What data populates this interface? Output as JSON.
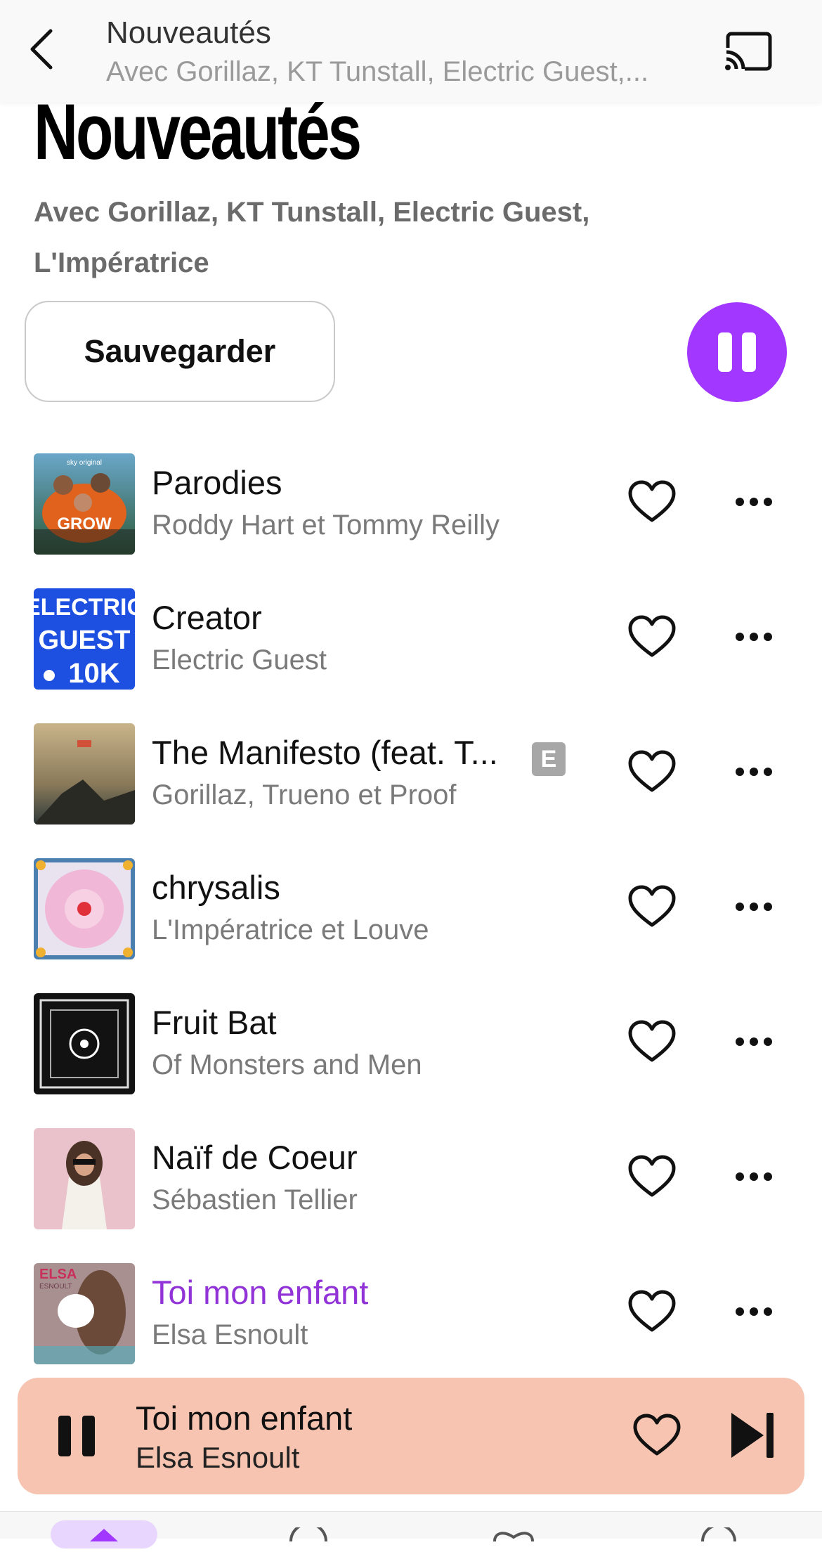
{
  "header": {
    "title": "Nouveautés",
    "subtitle": "Avec Gorillaz, KT Tunstall, Electric Guest,..."
  },
  "hero": {
    "title": "Nouveautés",
    "artists": "Avec Gorillaz, KT Tunstall, Electric Guest, L'Impératrice",
    "save_label": "Sauvegarder",
    "accent_color": "#a238ff"
  },
  "tracks": [
    {
      "title": "Parodies",
      "artist": "Roddy Hart et Tommy Reilly",
      "explicit": false,
      "playing": false,
      "cover_text": "GROW",
      "cover_top": "sky original"
    },
    {
      "title": "Creator",
      "artist": "Electric Guest",
      "explicit": false,
      "playing": false,
      "cover_text": "ELECTRIC GUEST 10K"
    },
    {
      "title": "The Manifesto (feat. T...",
      "artist": "Gorillaz, Trueno et Proof",
      "explicit": true,
      "explicit_label": "E",
      "playing": false
    },
    {
      "title": "chrysalis",
      "artist": "L'Impératrice et Louve",
      "explicit": false,
      "playing": false
    },
    {
      "title": "Fruit Bat",
      "artist": "Of Monsters and Men",
      "explicit": false,
      "playing": false
    },
    {
      "title": "Naïf de Coeur",
      "artist": "Sébastien Tellier",
      "explicit": false,
      "playing": false
    },
    {
      "title": "Toi mon enfant",
      "artist": "Elsa Esnoult",
      "explicit": false,
      "playing": true,
      "cover_text": "ELSA ESNOULT"
    }
  ],
  "now_playing": {
    "title": "Toi mon enfant",
    "artist": "Elsa Esnoult",
    "background": "#f6c4b1"
  },
  "icons": {
    "back": "chevron-left-icon",
    "cast": "cast-icon",
    "pause": "pause-icon",
    "heart": "heart-icon",
    "more": "more-horizontal-icon",
    "next": "skip-next-icon"
  }
}
